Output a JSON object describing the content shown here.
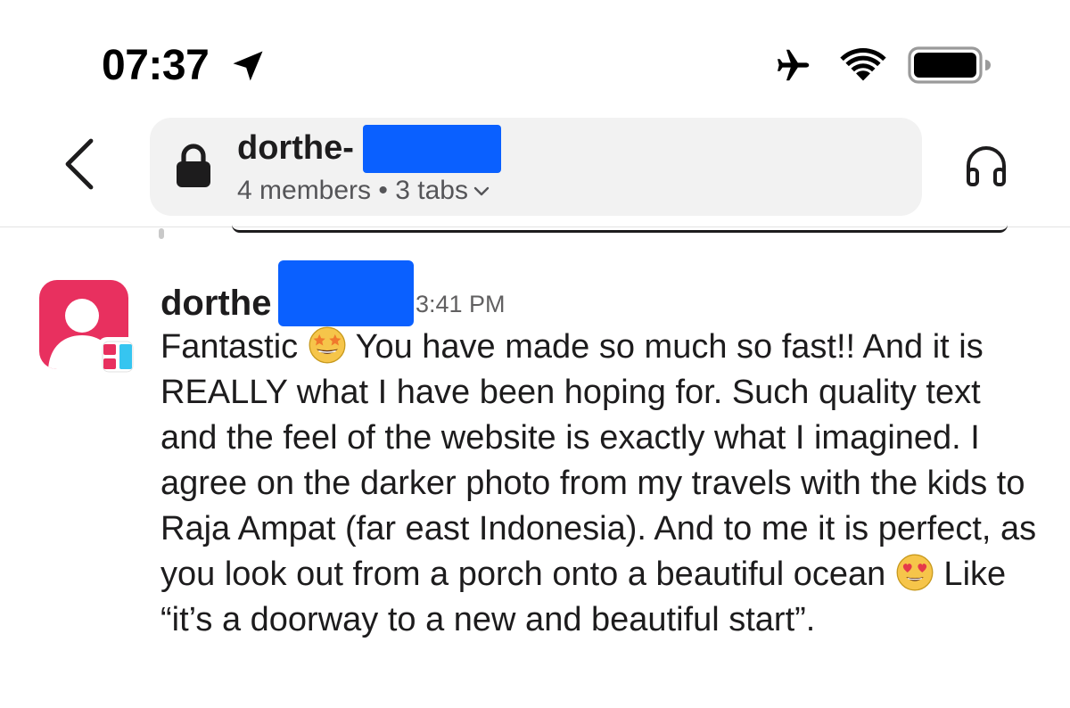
{
  "status_bar": {
    "time": "07:37",
    "icons": [
      "location-arrow-icon",
      "airplane-icon",
      "wifi-icon",
      "battery-icon"
    ]
  },
  "header": {
    "channel_name": "dorthe-",
    "meta": "4 members • 3 tabs",
    "icons": [
      "back-chevron-icon",
      "lock-icon",
      "chevron-down-icon",
      "headphones-icon"
    ]
  },
  "message": {
    "sender": "dorthe",
    "time": "3:41 PM",
    "segments": [
      "Fantastic ",
      " You have made so much so fast!! And it is REALLY what I have been hoping for. Such quality text and the feel of the website is exactly what I imagined. I agree on the darker photo from my travels with the kids to Raja Ampat (far east Indonesia). And to me it is perfect, as you look out from a porch onto a beautiful ocean ",
      " Like “it’s a doorway to a new and beautiful start”."
    ],
    "emojis": [
      "star-struck-emoji",
      "heart-eyes-emoji"
    ]
  },
  "colors": {
    "redaction": "#0a60ff",
    "avatar_pink": "#e8305f",
    "header_bg": "#f2f2f2",
    "text": "#1d1c1d"
  }
}
